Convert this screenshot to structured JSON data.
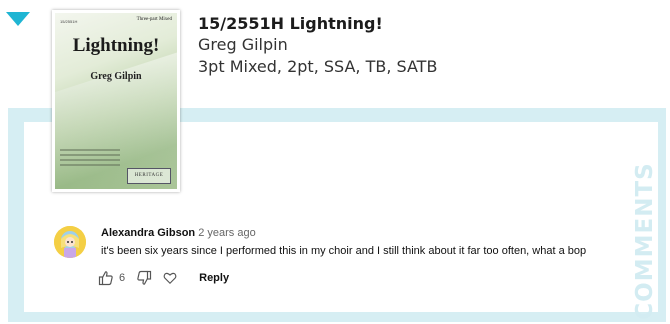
{
  "item": {
    "title": "15/2551H Lightning!",
    "composer": "Greg Gilpin",
    "voicings": "3pt Mixed, 2pt, SSA, TB, SATB"
  },
  "cover": {
    "code": "15/2551H",
    "voicing": "Three-part Mixed",
    "title": "Lightning!",
    "composer": "Greg Gilpin",
    "publisher": "HERITAGE"
  },
  "panel": {
    "side_label": "COMMENTS"
  },
  "comment": {
    "author": "Alexandra Gibson",
    "time": "2 years ago",
    "text": "it's been six years since I performed this in my choir and I still think about it far too often, what a bop",
    "likes": "6",
    "reply_label": "Reply"
  },
  "colors": {
    "accent": "#1fb5d3",
    "panel_bg": "#d6eef3",
    "side_text": "#d3ecf2"
  },
  "icons": [
    "triangle-down-icon",
    "thumbs-up-icon",
    "thumbs-down-icon",
    "heart-icon"
  ]
}
